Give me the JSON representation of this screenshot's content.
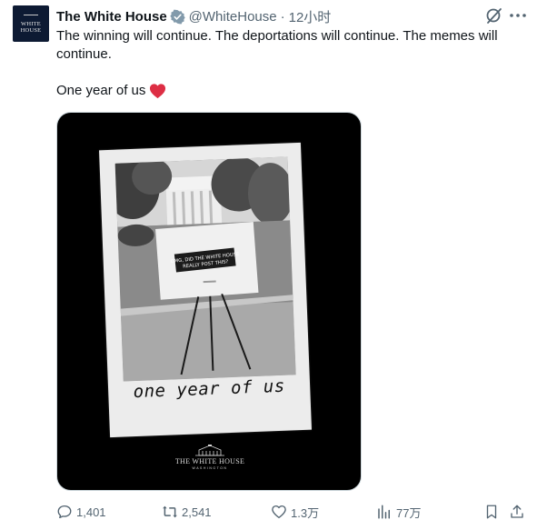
{
  "tweet": {
    "author": {
      "display_name": "The White House",
      "handle": "@WhiteHouse",
      "avatar_line1": "WHITE",
      "avatar_line2": "HOUSE",
      "verified": true
    },
    "separator": "·",
    "time": "12小时",
    "text_line1": "The winning will continue. The deportations will continue. The memes will continue.",
    "text_line2": "One year of us",
    "emoji": "heart-emoji",
    "media": {
      "sign_text_line1": "OMG, DID THE WHITE HOUSE",
      "sign_text_line2": "REALLY POST THIS?",
      "caption": "one year of us",
      "logo_line1": "THE WHITE HOUSE",
      "logo_line2": "WASHINGTON"
    },
    "actions": {
      "reply_count": "1,401",
      "retweet_count": "2,541",
      "like_count": "1.3万",
      "views_count": "77万"
    }
  },
  "icons": {
    "verified": "verified-badge-icon",
    "grok": "grok-icon",
    "more": "more-icon",
    "reply": "reply-icon",
    "retweet": "retweet-icon",
    "like": "like-icon",
    "views": "views-icon",
    "bookmark": "bookmark-icon",
    "share": "share-icon"
  },
  "colors": {
    "text_primary": "#0f1419",
    "text_secondary": "#536471",
    "heart": "#f91880",
    "verified_gray": "#829aab",
    "media_bg": "#000000"
  }
}
